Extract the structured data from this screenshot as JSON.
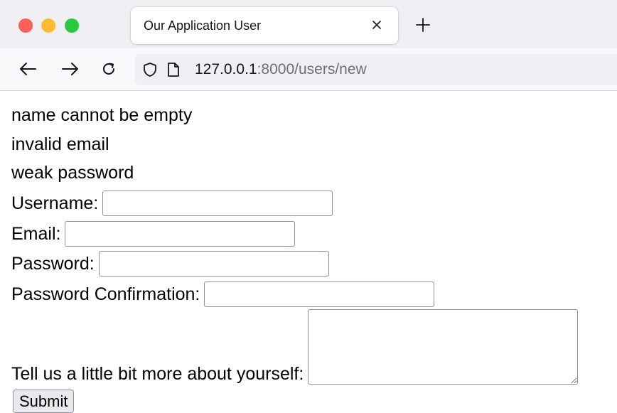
{
  "browser": {
    "tab_title": "Our Application User",
    "url_host": "127.0.0.1",
    "url_rest": ":8000/users/new"
  },
  "errors": [
    "name cannot be empty",
    "invalid email",
    "weak password"
  ],
  "form": {
    "username_label": "Username:",
    "username_value": "",
    "email_label": "Email:",
    "email_value": "",
    "password_label": "Password:",
    "password_value": "",
    "password_confirmation_label": "Password Confirmation:",
    "password_confirmation_value": "",
    "about_label": "Tell us a little bit more about yourself:",
    "about_value": "",
    "submit_label": "Submit"
  },
  "icons": {
    "window_controls": [
      "close-window-icon",
      "minimize-window-icon",
      "zoom-window-icon"
    ],
    "tab_close": "close-icon",
    "new_tab": "plus-icon",
    "nav": [
      "back-arrow-icon",
      "forward-arrow-icon",
      "reload-icon"
    ],
    "url": [
      "shield-icon",
      "page-icon"
    ]
  },
  "colors": {
    "traffic_red": "#fe5f57",
    "traffic_yellow": "#febc2e",
    "traffic_green": "#28c840",
    "chrome_bg": "#f0f0f4",
    "url_host": "#15141a",
    "url_rest": "#6e6e76"
  }
}
